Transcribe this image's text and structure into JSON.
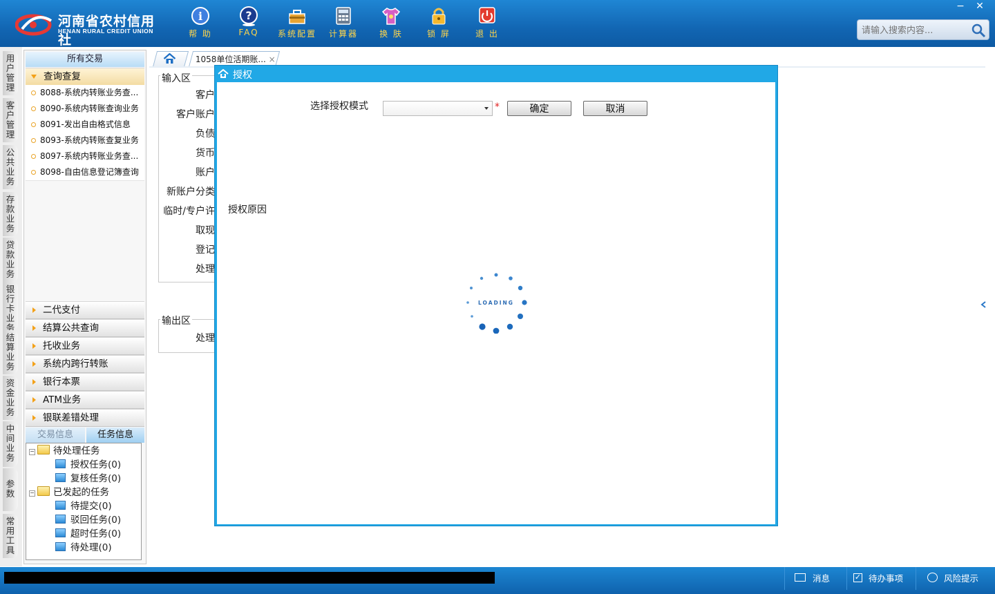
{
  "header": {
    "logo_cn": "河南省农村信用社",
    "logo_en": "HENAN RURAL CREDIT UNION",
    "toolbar": [
      {
        "label": "帮 助",
        "icon": "info-icon"
      },
      {
        "label": "FAQ",
        "icon": "question-icon"
      },
      {
        "label": "系统配置",
        "icon": "toolbox-icon"
      },
      {
        "label": "计算器",
        "icon": "calculator-icon"
      },
      {
        "label": "换 肤",
        "icon": "shirt-icon"
      },
      {
        "label": "锁 屏",
        "icon": "lock-icon"
      },
      {
        "label": "退 出",
        "icon": "power-icon"
      }
    ],
    "window_controls": {
      "minimize": "−",
      "close": "✕"
    },
    "search": {
      "placeholder": "请输入搜索内容..."
    }
  },
  "vtabs": [
    "用户管理",
    "客户管理",
    "公共业务",
    "存款业务",
    "贷款业务",
    "银行卡业务",
    "结算业务",
    "资金业务",
    "中间业务",
    "参数",
    "常用工具"
  ],
  "sidebar": {
    "header": "所有交易",
    "expanded_group": "查询查复",
    "items": [
      "8088-系统内转账业务查...",
      "8090-系统内转账查询业务",
      "8091-发出自由格式信息",
      "8093-系统内转账查复业务",
      "8097-系统内转账业务查...",
      "8098-自由信息登记簿查询"
    ],
    "groups": [
      "二代支付",
      "结算公共查询",
      "托收业务",
      "系统内跨行转账",
      "银行本票",
      "ATM业务",
      "银联差错处理"
    ],
    "bottom_tabs": [
      "交易信息",
      "任务信息"
    ],
    "tree": {
      "pending": "待处理任务",
      "pending_children": [
        "授权任务(0)",
        "复核任务(0)"
      ],
      "initiated": "已发起的任务",
      "initiated_children": [
        "待提交(0)",
        "驳回任务(0)",
        "超时任务(0)",
        "待处理(0)"
      ]
    }
  },
  "tabs": {
    "active_label": "1058单位活期账...",
    "close": "×"
  },
  "form": {
    "input_legend": "输入区",
    "labels": [
      "客户",
      "客户账户",
      "负债",
      "货币",
      "账户",
      "新账户分类",
      "临时/专户许",
      "取现",
      "登记",
      "处理"
    ],
    "output_legend": "输出区",
    "output_label": "处理"
  },
  "dialog": {
    "title": "授权",
    "mode_label": "选择授权模式",
    "mode_value": "",
    "required_mark": "*",
    "ok": "确定",
    "cancel": "取消",
    "reason_label": "授权原因",
    "loading": "LOADING"
  },
  "statusbar": {
    "messages": "消息",
    "todo": "待办事项",
    "risk": "风险提示"
  },
  "colors": {
    "header_blue": "#1266b3",
    "dialog_blue": "#21a8e6",
    "toolbar_label": "#ffd54a",
    "spinner": "#1a73c9"
  }
}
